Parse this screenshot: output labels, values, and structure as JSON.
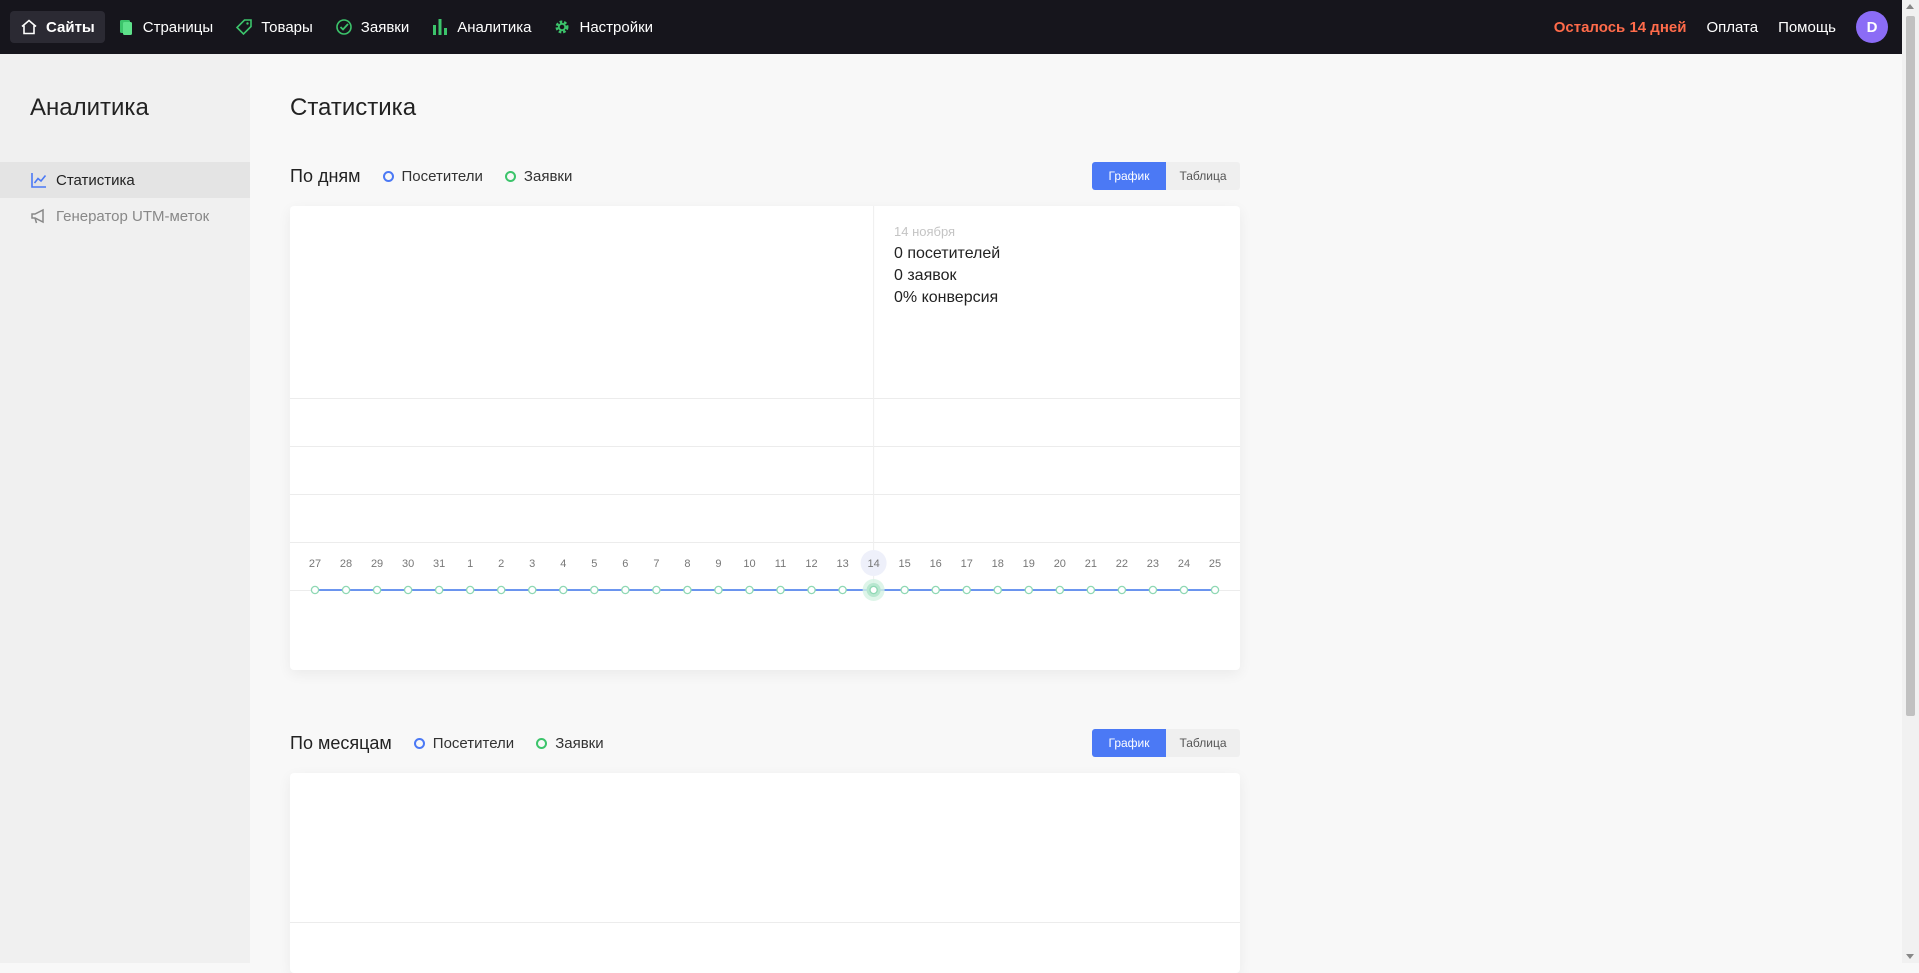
{
  "nav": {
    "items": [
      {
        "label": "Сайты",
        "icon": "home-icon",
        "active": true
      },
      {
        "label": "Страницы",
        "icon": "pages-icon"
      },
      {
        "label": "Товары",
        "icon": "tag-icon"
      },
      {
        "label": "Заявки",
        "icon": "target-icon"
      },
      {
        "label": "Аналитика",
        "icon": "bar-chart-icon"
      },
      {
        "label": "Настройки",
        "icon": "gear-icon"
      }
    ],
    "trial_notice": "Осталось 14 дней",
    "payment": "Оплата",
    "help": "Помощь",
    "avatar_letter": "D"
  },
  "sidebar": {
    "title": "Аналитика",
    "items": [
      {
        "label": "Статистика",
        "icon": "line-chart-icon",
        "active": true
      },
      {
        "label": "Генератор UTM-меток",
        "icon": "megaphone-icon"
      }
    ]
  },
  "main": {
    "title": "Статистика",
    "daily": {
      "title": "По дням",
      "legend": [
        "Посетители",
        "Заявки"
      ],
      "toggle": [
        "График",
        "Таблица"
      ],
      "tooltip": {
        "date": "14 ноября",
        "visitors": "0 посетителей",
        "requests": "0 заявок",
        "conversion": "0% конверсия"
      }
    },
    "monthly": {
      "title": "По месяцам",
      "legend": [
        "Посетители",
        "Заявки"
      ],
      "toggle": [
        "График",
        "Таблица"
      ]
    }
  },
  "colors": {
    "visitors": "#4b79f5",
    "requests": "#3cc46b",
    "accent": "#4b79f5",
    "trial": "#ff6b4a",
    "line": "#9fdcc3"
  },
  "chart_data": {
    "type": "line",
    "categories": [
      "27",
      "28",
      "29",
      "30",
      "31",
      "1",
      "2",
      "3",
      "4",
      "5",
      "6",
      "7",
      "8",
      "9",
      "10",
      "11",
      "12",
      "13",
      "14",
      "15",
      "16",
      "17",
      "18",
      "19",
      "20",
      "21",
      "22",
      "23",
      "24",
      "25"
    ],
    "series": [
      {
        "name": "Посетители",
        "values": [
          0,
          0,
          0,
          0,
          0,
          0,
          0,
          0,
          0,
          0,
          0,
          0,
          0,
          0,
          0,
          0,
          0,
          0,
          0,
          0,
          0,
          0,
          0,
          0,
          0,
          0,
          0,
          0,
          0,
          0
        ]
      },
      {
        "name": "Заявки",
        "values": [
          0,
          0,
          0,
          0,
          0,
          0,
          0,
          0,
          0,
          0,
          0,
          0,
          0,
          0,
          0,
          0,
          0,
          0,
          0,
          0,
          0,
          0,
          0,
          0,
          0,
          0,
          0,
          0,
          0,
          0
        ]
      }
    ],
    "highlighted_category": "14",
    "grid": true,
    "legend_position": "top"
  }
}
